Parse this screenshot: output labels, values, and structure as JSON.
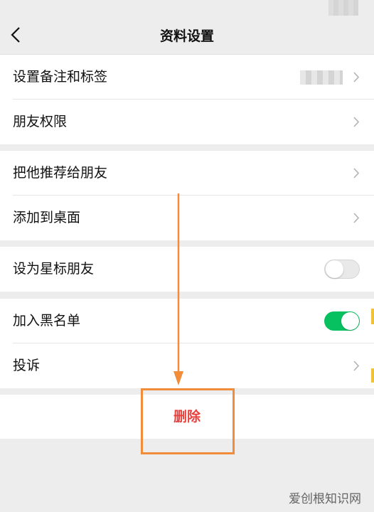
{
  "header": {
    "title": "资料设置"
  },
  "groups": [
    {
      "items": [
        {
          "label": "设置备注和标签"
        },
        {
          "label": "朋友权限"
        }
      ]
    },
    {
      "items": [
        {
          "label": "把他推荐给朋友"
        },
        {
          "label": "添加到桌面"
        }
      ]
    },
    {
      "items": [
        {
          "label": "设为星标朋友",
          "toggle": false
        }
      ]
    },
    {
      "items": [
        {
          "label": "加入黑名单",
          "toggle": true
        },
        {
          "label": "投诉"
        }
      ]
    }
  ],
  "delete_label": "删除",
  "watermark": "爱创根知识网",
  "colors": {
    "toggle_on": "#07c160",
    "delete_text": "#e64340",
    "highlight": "#f08c3a"
  }
}
